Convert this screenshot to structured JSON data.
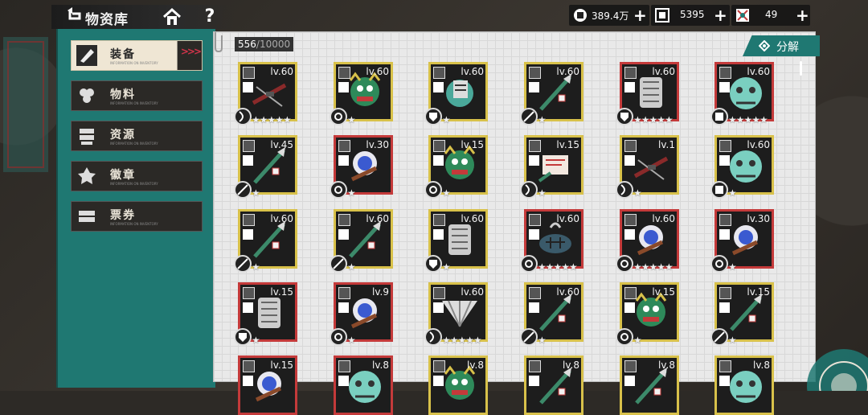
{
  "header": {
    "back_label": "物资库",
    "help_label": "?",
    "currencies": [
      {
        "icon": "coin-icon",
        "value": "389.4万",
        "plus": "+"
      },
      {
        "icon": "crate-icon",
        "value": "5395",
        "plus": "+"
      },
      {
        "icon": "gem-icon",
        "value": "49",
        "plus": "+"
      }
    ]
  },
  "sidebar": {
    "items": [
      {
        "label": "装备",
        "active": true,
        "icon": "equipment-icon"
      },
      {
        "label": "物料",
        "active": false,
        "icon": "materials-icon"
      },
      {
        "label": "资源",
        "active": false,
        "icon": "resources-icon"
      },
      {
        "label": "徽章",
        "active": false,
        "icon": "badge-icon"
      },
      {
        "label": "票券",
        "active": false,
        "icon": "ticket-icon"
      }
    ],
    "sub_caption": "INFORMATION ON INVENTORY",
    "active_arrows": ">>>"
  },
  "inventory": {
    "count": "556",
    "capacity": "/10000",
    "decompose_label": "分解",
    "colors": {
      "gold": "#d8c14a",
      "red": "#c43a3a",
      "teal": "#1f7872"
    },
    "rows": [
      [
        {
          "level": "lv.60",
          "frame": "gold",
          "art": "crossbow",
          "stars": "★★★★★",
          "type": "bow"
        },
        {
          "level": "lv.60",
          "frame": "gold",
          "art": "mask",
          "stars": "★",
          "type": "gear"
        },
        {
          "level": "lv.60",
          "frame": "gold",
          "art": "mask2",
          "stars": "★",
          "type": "shield"
        },
        {
          "level": "lv.60",
          "frame": "gold",
          "art": "spear",
          "stars": "★",
          "type": "spear"
        },
        {
          "level": "lv.60",
          "frame": "red",
          "art": "gatling",
          "stars": "★★★★★",
          "type": "shield"
        },
        {
          "level": "lv.60",
          "frame": "red",
          "art": "beast",
          "stars": "★★★★★",
          "type": "armor"
        }
      ],
      [
        {
          "level": "lv.45",
          "frame": "gold",
          "art": "spear",
          "stars": "★",
          "type": "spear"
        },
        {
          "level": "lv.30",
          "frame": "red",
          "art": "orb",
          "stars": "★",
          "type": "gear"
        },
        {
          "level": "lv.15",
          "frame": "gold",
          "art": "mask",
          "stars": "★",
          "type": "gear"
        },
        {
          "level": "lv.15",
          "frame": "gold",
          "art": "scroll",
          "stars": "★",
          "type": "bow"
        },
        {
          "level": "lv.1",
          "frame": "gold",
          "art": "crossbow",
          "stars": "★",
          "type": "bow"
        },
        {
          "level": "lv.60",
          "frame": "gold",
          "art": "beast",
          "stars": "★",
          "type": "armor"
        }
      ],
      [
        {
          "level": "lv.60",
          "frame": "gold",
          "art": "spear",
          "stars": "★",
          "type": "spear"
        },
        {
          "level": "lv.60",
          "frame": "gold",
          "art": "spear",
          "stars": "★",
          "type": "spear"
        },
        {
          "level": "lv.60",
          "frame": "gold",
          "art": "gatling",
          "stars": "★",
          "type": "shield"
        },
        {
          "level": "lv.60",
          "frame": "red",
          "art": "turtle",
          "stars": "★★★★★",
          "type": "gear"
        },
        {
          "level": "lv.60",
          "frame": "red",
          "art": "orb",
          "stars": "★★★★★",
          "type": "gear"
        },
        {
          "level": "lv.30",
          "frame": "red",
          "art": "orb",
          "stars": "★",
          "type": "gear"
        }
      ],
      [
        {
          "level": "lv.15",
          "frame": "red",
          "art": "gatling",
          "stars": "★",
          "type": "shield"
        },
        {
          "level": "lv.9",
          "frame": "red",
          "art": "orb",
          "stars": "★",
          "type": "gear"
        },
        {
          "level": "lv.60",
          "frame": "gold",
          "art": "fan",
          "stars": "★★★★★",
          "type": "bow"
        },
        {
          "level": "lv.60",
          "frame": "gold",
          "art": "spear",
          "stars": "★",
          "type": "spear"
        },
        {
          "level": "lv.15",
          "frame": "gold",
          "art": "mask",
          "stars": "★",
          "type": "gear"
        },
        {
          "level": "lv.15",
          "frame": "gold",
          "art": "spear",
          "stars": "★",
          "type": "spear"
        }
      ],
      [
        {
          "level": "lv.15",
          "frame": "red",
          "art": "orb",
          "stars": "",
          "type": ""
        },
        {
          "level": "lv.8",
          "frame": "red",
          "art": "beast",
          "stars": "",
          "type": ""
        },
        {
          "level": "lv.8",
          "frame": "gold",
          "art": "mask",
          "stars": "",
          "type": ""
        },
        {
          "level": "lv.8",
          "frame": "gold",
          "art": "spear",
          "stars": "",
          "type": ""
        },
        {
          "level": "lv.8",
          "frame": "gold",
          "art": "spear",
          "stars": "",
          "type": ""
        },
        {
          "level": "lv.8",
          "frame": "gold",
          "art": "beast",
          "stars": "",
          "type": ""
        }
      ]
    ]
  }
}
